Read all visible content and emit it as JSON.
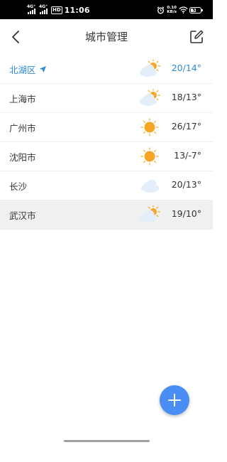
{
  "status_bar": {
    "signal1_label": "4G⁺",
    "signal2_label": "4G⁺",
    "hd_label": "HD",
    "time": "11:06",
    "net_speed_value": "0.10",
    "net_speed_unit": "KB/s",
    "battery_level": "51",
    "battery_fraction": 0.51
  },
  "header": {
    "title": "城市管理"
  },
  "cities": [
    {
      "name": "北湖区",
      "temp": "20/14°",
      "weather": "partly-cloudy",
      "current": true
    },
    {
      "name": "上海市",
      "temp": "18/13°",
      "weather": "partly-cloudy",
      "current": false
    },
    {
      "name": "广州市",
      "temp": "26/17°",
      "weather": "sunny",
      "current": false
    },
    {
      "name": "沈阳市",
      "temp": "13/-7°",
      "weather": "sunny",
      "current": false
    },
    {
      "name": "长沙",
      "temp": "20/13°",
      "weather": "cloudy",
      "current": false
    },
    {
      "name": "武汉市",
      "temp": "19/10°",
      "weather": "partly-cloudy",
      "current": false
    }
  ],
  "selected_city_index": 5,
  "colors": {
    "accent": "#2e8bd8",
    "fab": "#4a8df5",
    "sun": "#f5a623",
    "cloud": "#e4eefb"
  },
  "icons": {
    "back": "back-arrow-icon",
    "edit": "edit-icon",
    "add": "plus-icon",
    "location": "location-arrow-icon"
  }
}
